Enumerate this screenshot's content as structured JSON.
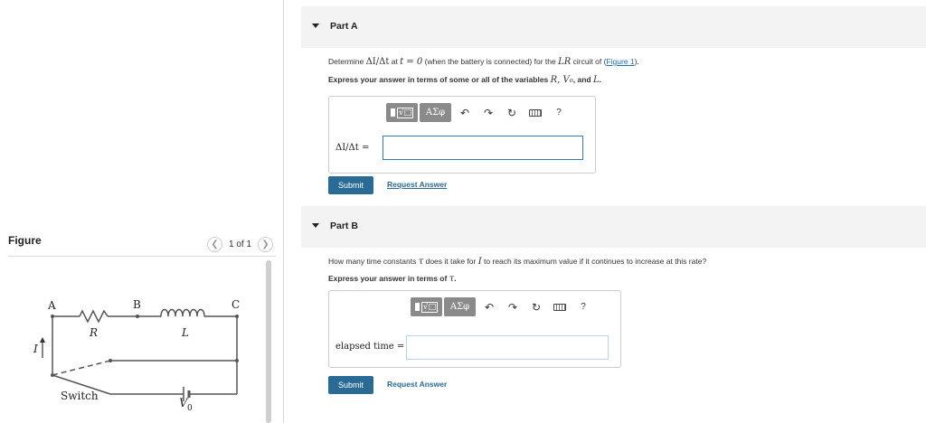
{
  "figure": {
    "title": "Figure",
    "pager": "1 of 1",
    "prev_icon": "chevron-left-icon",
    "next_icon": "chevron-right-icon",
    "labels": {
      "a": "A",
      "b": "B",
      "c": "C",
      "r": "R",
      "l": "L",
      "i": "I",
      "switch": "Switch",
      "v0": "V",
      "v0_sub": "0"
    }
  },
  "part_a": {
    "title": "Part A",
    "q_prefix": "Determine ",
    "q_delta": "ΔI/Δt",
    "q_at": " at ",
    "q_t0": "t = 0",
    "q_mid": " (when the battery is connected) for the ",
    "q_lr": "LR",
    "q_circuit": " circuit of (",
    "q_link": "Figure 1",
    "q_end": ").",
    "inst_prefix": "Express your answer in terms of some or all of the variables ",
    "inst_vars": "R, V₀",
    "inst_and": ", and ",
    "inst_l": "L",
    "inst_end": ".",
    "answer_label": "ΔI/Δt =",
    "answer_value": "",
    "submit": "Submit",
    "request": "Request Answer"
  },
  "part_b": {
    "title": "Part B",
    "q_prefix": "How many time constants ",
    "q_tau": "τ",
    "q_mid": " does it take for ",
    "q_i": "I",
    "q_end": " to reach its maximum value if it continues to increase at this rate?",
    "inst_prefix": "Express your answer in terms of ",
    "inst_tau": "τ",
    "inst_end": ".",
    "answer_label": "elapsed time =",
    "answer_value": "",
    "submit": "Submit",
    "request": "Request Answer"
  },
  "toolbar": {
    "template_label": "√□",
    "greek_label": "ΑΣφ",
    "undo": "↶",
    "redo": "↷",
    "reset": "↻",
    "help": "?",
    "icons": [
      "template-icon",
      "greek-icon",
      "undo-icon",
      "redo-icon",
      "reset-icon",
      "keyboard-icon",
      "help-icon"
    ]
  },
  "colors": {
    "accent": "#2a6b96",
    "link": "#1f6fb5",
    "toolbar_btn": "#8a8a8a",
    "header_bg": "#f3f3f3"
  }
}
